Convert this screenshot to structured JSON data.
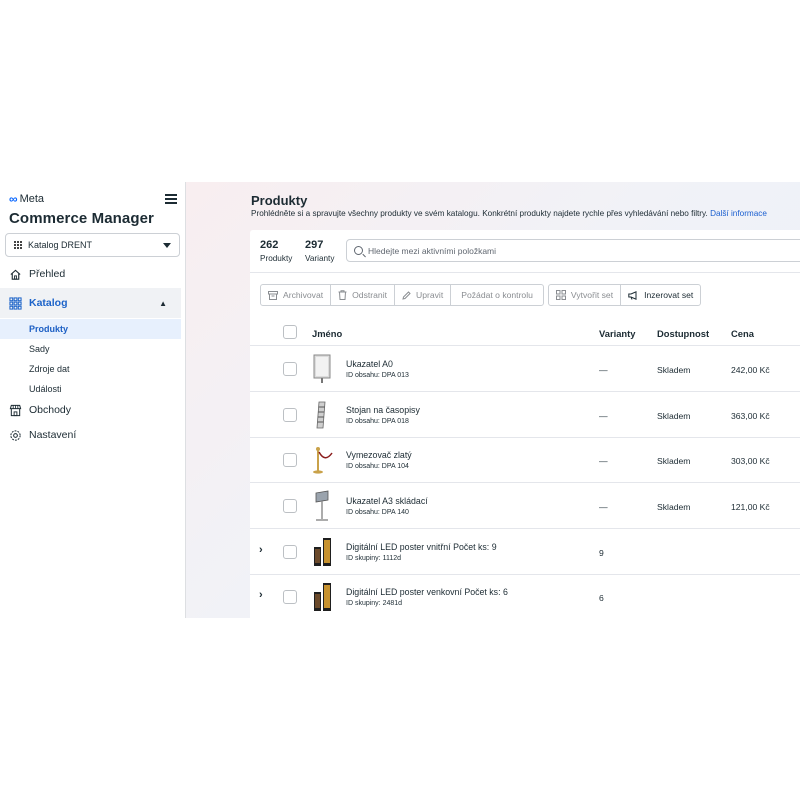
{
  "sidebar": {
    "brand": "Meta",
    "app_title": "Commerce Manager",
    "catalog_selector": "Katalog DRENT",
    "nav": {
      "overview": "Přehled",
      "catalog": "Katalog",
      "catalog_sub": [
        "Produkty",
        "Sady",
        "Zdroje dat",
        "Události"
      ],
      "shops": "Obchody",
      "settings": "Nastavení"
    }
  },
  "header": {
    "title": "Produkty",
    "description": "Prohlédněte si a spravujte všechny produkty ve svém katalogu. Konkrétní produkty najdete rychle přes vyhledávání nebo filtry.",
    "more_link": "Další informace"
  },
  "stats": [
    {
      "value": "262",
      "label": "Produkty"
    },
    {
      "value": "297",
      "label": "Varianty"
    }
  ],
  "search": {
    "placeholder": "Hledejte mezi aktivními položkami"
  },
  "toolbar": {
    "archive": "Archivovat",
    "delete": "Odstranit",
    "edit": "Upravit",
    "request_review": "Požádat o kontrolu",
    "create_set": "Vytvořit set",
    "advertise_set": "Inzerovat set"
  },
  "table": {
    "columns": {
      "name": "Jméno",
      "variants": "Varianty",
      "availability": "Dostupnost",
      "price": "Cena"
    },
    "rows": [
      {
        "name": "Ukazatel A0",
        "sub": "ID obsahu: DPA 013",
        "variants": "—",
        "availability": "Skladem",
        "price": "242,00 Kč",
        "thumb": "board-a0"
      },
      {
        "name": "Stojan na časopisy",
        "sub": "ID obsahu: DPA 018",
        "variants": "—",
        "availability": "Skladem",
        "price": "363,00 Kč",
        "thumb": "magazine-rack"
      },
      {
        "name": "Vymezovač zlatý",
        "sub": "ID obsahu: DPA 104",
        "variants": "—",
        "availability": "Skladem",
        "price": "303,00 Kč",
        "thumb": "rope-post"
      },
      {
        "name": "Ukazatel A3 skládací",
        "sub": "ID obsahu: DPA 140",
        "variants": "—",
        "availability": "Skladem",
        "price": "121,00 Kč",
        "thumb": "a3-stand"
      },
      {
        "name": "Digitální LED poster vnitřní Počet ks: 9",
        "sub": "ID skupiny: 1112d",
        "variants": "9",
        "availability": "",
        "price": "",
        "thumb": "led-poster"
      },
      {
        "name": "Digitální LED poster venkovní Počet ks: 6",
        "sub": "ID skupiny: 2481d",
        "variants": "6",
        "availability": "",
        "price": "",
        "thumb": "led-poster"
      }
    ]
  },
  "colors": {
    "accent": "#1c63c9",
    "meta_blue": "#0866ff",
    "active_bg": "#e7f0fd"
  }
}
